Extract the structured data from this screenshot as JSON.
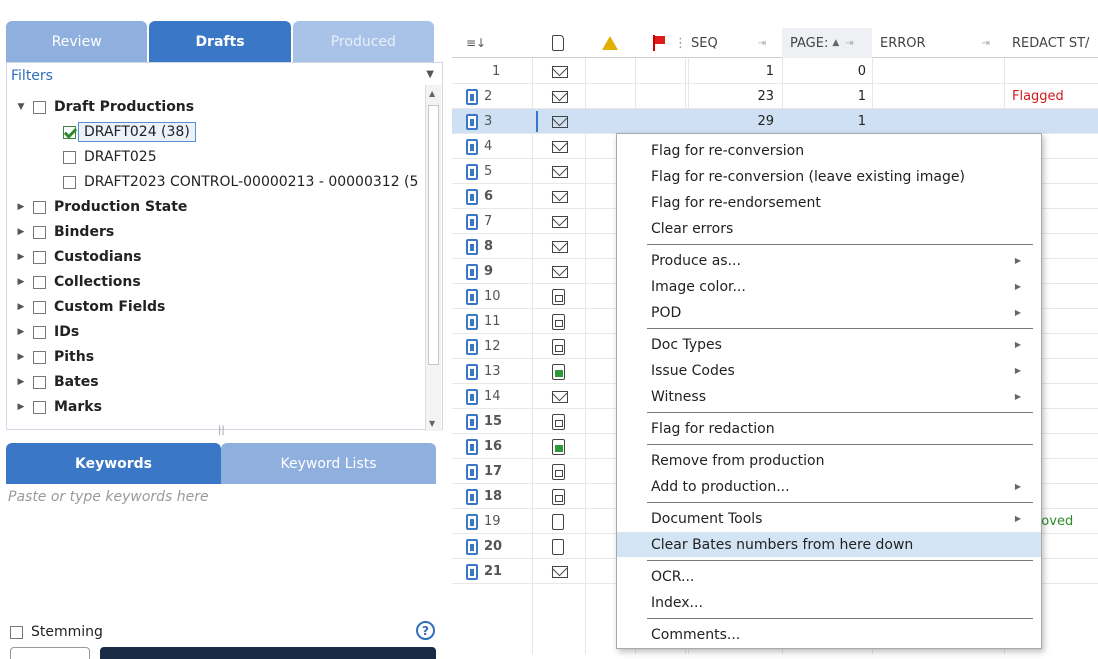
{
  "left": {
    "tabs": [
      "Review",
      "Drafts",
      "Produced"
    ],
    "filters_label": "Filters",
    "tree": [
      {
        "label": "Draft Productions",
        "bold": true,
        "arrow": "down",
        "checked": false
      },
      {
        "label": "DRAFT024 (38)",
        "bold": false,
        "arrow": "",
        "checked": true,
        "selected": true
      },
      {
        "label": "DRAFT025",
        "bold": false,
        "arrow": "",
        "checked": false
      },
      {
        "label": "DRAFT2023 CONTROL-00000213 - 00000312 (5",
        "bold": false,
        "arrow": "",
        "checked": false
      },
      {
        "label": "Production State",
        "bold": true,
        "arrow": "right",
        "checked": false
      },
      {
        "label": "Binders",
        "bold": true,
        "arrow": "right",
        "checked": false
      },
      {
        "label": "Custodians",
        "bold": true,
        "arrow": "right",
        "checked": false
      },
      {
        "label": "Collections",
        "bold": true,
        "arrow": "right",
        "checked": false
      },
      {
        "label": "Custom Fields",
        "bold": true,
        "arrow": "right",
        "checked": false
      },
      {
        "label": "IDs",
        "bold": true,
        "arrow": "right",
        "checked": false
      },
      {
        "label": "Piths",
        "bold": true,
        "arrow": "right",
        "checked": false
      },
      {
        "label": "Bates",
        "bold": true,
        "arrow": "right",
        "checked": false
      },
      {
        "label": "Marks",
        "bold": true,
        "arrow": "right",
        "checked": false
      }
    ],
    "keyword_tabs": [
      "Keywords",
      "Keyword Lists"
    ],
    "keyword_placeholder": "Paste or type keywords here",
    "stemming_label": "Stemming"
  },
  "grid": {
    "headers": {
      "seq": "SEQ",
      "pages": "PAGE:",
      "error": "ERROR",
      "redact": "REDACT ST/"
    },
    "rows": [
      {
        "n": "1",
        "bold": false,
        "doc": false,
        "type": "env",
        "seq": "1",
        "pages": "0",
        "redact": "",
        "redact_color": ""
      },
      {
        "n": "2",
        "bold": false,
        "doc": true,
        "type": "env",
        "seq": "23",
        "pages": "1",
        "redact": "Flagged",
        "redact_color": "#d11a1a"
      },
      {
        "n": "3",
        "bold": false,
        "doc": true,
        "type": "env",
        "seq": "29",
        "pages": "1",
        "redact": "",
        "redact_color": "",
        "selected": true
      },
      {
        "n": "4",
        "bold": false,
        "doc": true,
        "type": "env",
        "seq": "",
        "pages": "",
        "redact": "",
        "redact_color": ""
      },
      {
        "n": "5",
        "bold": false,
        "doc": true,
        "type": "env",
        "seq": "",
        "pages": "",
        "redact": "",
        "redact_color": ""
      },
      {
        "n": "6",
        "bold": true,
        "doc": true,
        "type": "env",
        "seq": "",
        "pages": "",
        "redact": "",
        "redact_color": ""
      },
      {
        "n": "7",
        "bold": false,
        "doc": true,
        "type": "env",
        "seq": "",
        "pages": "",
        "redact": "",
        "redact_color": ""
      },
      {
        "n": "8",
        "bold": true,
        "doc": true,
        "type": "env",
        "seq": "",
        "pages": "",
        "redact": "",
        "redact_color": ""
      },
      {
        "n": "9",
        "bold": true,
        "doc": true,
        "type": "env",
        "seq": "",
        "pages": "",
        "redact": "",
        "redact_color": ""
      },
      {
        "n": "10",
        "bold": false,
        "doc": true,
        "type": "pages",
        "seq": "",
        "pages": "",
        "redact": "",
        "redact_color": ""
      },
      {
        "n": "11",
        "bold": false,
        "doc": true,
        "type": "pages",
        "seq": "",
        "pages": "",
        "redact": "",
        "redact_color": ""
      },
      {
        "n": "12",
        "bold": false,
        "doc": true,
        "type": "pages",
        "seq": "",
        "pages": "",
        "redact": "",
        "redact_color": ""
      },
      {
        "n": "13",
        "bold": false,
        "doc": true,
        "type": "pages-green",
        "seq": "",
        "pages": "",
        "redact": "",
        "redact_color": ""
      },
      {
        "n": "14",
        "bold": false,
        "doc": true,
        "type": "env",
        "seq": "",
        "pages": "",
        "redact": "",
        "redact_color": ""
      },
      {
        "n": "15",
        "bold": true,
        "doc": true,
        "type": "pages",
        "seq": "",
        "pages": "",
        "redact": "",
        "redact_color": ""
      },
      {
        "n": "16",
        "bold": true,
        "doc": true,
        "type": "pages-green",
        "seq": "",
        "pages": "",
        "redact": "",
        "redact_color": ""
      },
      {
        "n": "17",
        "bold": true,
        "doc": true,
        "type": "pages",
        "seq": "",
        "pages": "",
        "redact": "",
        "redact_color": ""
      },
      {
        "n": "18",
        "bold": true,
        "doc": true,
        "type": "pages",
        "seq": "",
        "pages": "",
        "redact": "",
        "redact_color": ""
      },
      {
        "n": "19",
        "bold": false,
        "doc": true,
        "type": "blank",
        "seq": "",
        "pages": "",
        "redact": "proved",
        "redact_color": "#2e8b2e"
      },
      {
        "n": "20",
        "bold": true,
        "doc": true,
        "type": "blank",
        "seq": "",
        "pages": "",
        "redact": "",
        "redact_color": ""
      },
      {
        "n": "21",
        "bold": true,
        "doc": true,
        "type": "env",
        "seq": "",
        "pages": "",
        "redact": "",
        "redact_color": ""
      }
    ]
  },
  "menu": [
    {
      "label": "Flag for re-conversion",
      "sub": false
    },
    {
      "label": "Flag for re-conversion (leave existing image)",
      "sub": false
    },
    {
      "label": "Flag for re-endorsement",
      "sub": false
    },
    {
      "label": "Clear errors",
      "sub": false,
      "sep_after": true
    },
    {
      "label": "Produce as...",
      "sub": true
    },
    {
      "label": "Image color...",
      "sub": true
    },
    {
      "label": "POD",
      "sub": true,
      "sep_after": true
    },
    {
      "label": "Doc Types",
      "sub": true
    },
    {
      "label": "Issue Codes",
      "sub": true
    },
    {
      "label": "Witness",
      "sub": true,
      "sep_after": true
    },
    {
      "label": "Flag for redaction",
      "sub": false,
      "sep_after": true
    },
    {
      "label": "Remove from production",
      "sub": false
    },
    {
      "label": "Add to production...",
      "sub": true,
      "sep_after": true
    },
    {
      "label": "Document Tools",
      "sub": true
    },
    {
      "label": "Clear Bates numbers from here down",
      "sub": false,
      "highlighted": true,
      "sep_after": true
    },
    {
      "label": "OCR...",
      "sub": false
    },
    {
      "label": "Index...",
      "sub": false,
      "sep_after": true
    },
    {
      "label": "Comments...",
      "sub": false
    }
  ],
  "colors": {
    "accent": "#3b77c7",
    "flagged": "#d11a1a",
    "approved": "#2e8b2e",
    "highlight": "#d3e4f5"
  },
  "icons": [
    "list-settings-icon",
    "document-icon",
    "warning-icon",
    "flag-icon",
    "envelope-icon",
    "pages-icon",
    "help-icon",
    "checkbox-icon"
  ]
}
